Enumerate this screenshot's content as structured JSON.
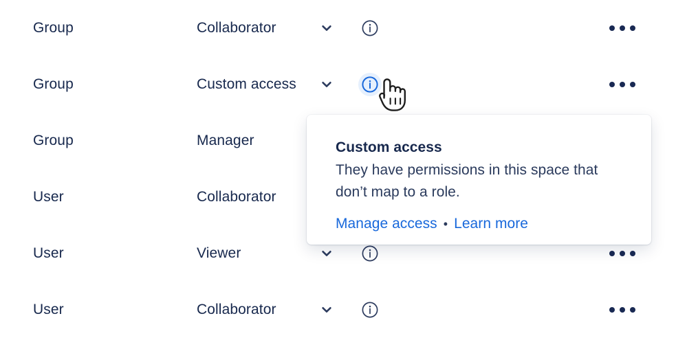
{
  "table": {
    "rows": [
      {
        "principal": "Group",
        "role": "Collaborator",
        "chevron_icon": "chevron-down-icon",
        "info_icon": "info-circle-icon",
        "more_icon": "more-actions-icon",
        "info_active": false
      },
      {
        "principal": "Group",
        "role": "Custom access",
        "chevron_icon": "chevron-down-icon",
        "info_icon": "info-circle-icon",
        "more_icon": "more-actions-icon",
        "info_active": true
      },
      {
        "principal": "Group",
        "role": "Manager",
        "chevron_icon": "chevron-down-icon",
        "info_icon": "info-circle-icon",
        "more_icon": "more-actions-icon",
        "info_active": false
      },
      {
        "principal": "User",
        "role": "Collaborator",
        "chevron_icon": "chevron-down-icon",
        "info_icon": "info-circle-icon",
        "more_icon": "more-actions-icon",
        "info_active": false
      },
      {
        "principal": "User",
        "role": "Viewer",
        "chevron_icon": "chevron-down-icon",
        "info_icon": "info-circle-icon",
        "more_icon": "more-actions-icon",
        "info_active": false
      },
      {
        "principal": "User",
        "role": "Collaborator",
        "chevron_icon": "chevron-down-icon",
        "info_icon": "info-circle-icon",
        "more_icon": "more-actions-icon",
        "info_active": false
      }
    ]
  },
  "popover": {
    "title": "Custom access",
    "body": "They have permissions in this space that don’t map to a role.",
    "manage_link": "Manage access",
    "separator": "•",
    "learn_link": "Learn more"
  },
  "cursor": {
    "icon": "pointing-hand-cursor"
  },
  "colors": {
    "text": "#17284D",
    "link": "#1868DB",
    "info_active_bg": "#E6F0FD",
    "info_active_fg": "#1868DB",
    "icon": "#192953",
    "surface": "#FFFFFF"
  }
}
